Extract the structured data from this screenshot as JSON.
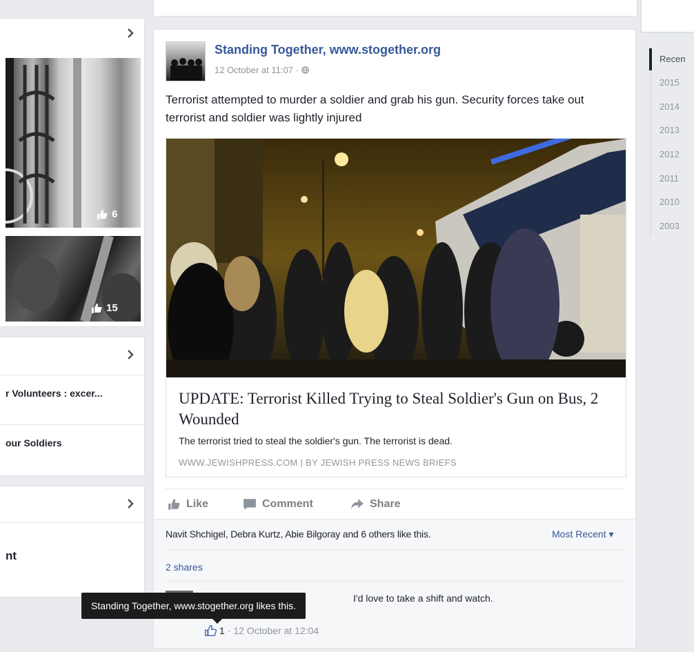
{
  "left": {
    "photo1_likes": "6",
    "photo2_likes": "15",
    "links": [
      {
        "label": "r Volunteers : excer..."
      },
      {
        "label": "our Soldiers"
      }
    ],
    "card3_text": "nt"
  },
  "post": {
    "page_name": "Standing Together, www.stogether.org",
    "timestamp": "12 October at 11:07 · ",
    "text": "Terrorist attempted to murder a soldier and grab his gun. Security forces take out terrorist and soldier was lightly injured",
    "link_preview": {
      "title": "UPDATE: Terrorist Killed Trying to Steal Soldier's Gun on Bus, 2 Wounded",
      "description": "The terrorist tried to steal the soldier's gun. The terrorist is dead.",
      "source": "WWW.JEWISHPRESS.COM | BY JEWISH PRESS NEWS BRIEFS"
    },
    "actions": {
      "like": "Like",
      "comment": "Comment",
      "share": "Share"
    },
    "likes_summary": "Navit Shchigel, Debra Kurtz, Abie Bilgoray and 6 others like this.",
    "sort_label": "Most Recent ▾",
    "shares": "2 shares",
    "comment": {
      "text": "I'd love to take a shift and watch.",
      "likes": "1",
      "timestamp": "· 12 October at 12:04"
    },
    "tooltip": "Standing Together, www.stogether.org likes this."
  },
  "timeline": {
    "recent": "Recen",
    "years": [
      "2015",
      "2014",
      "2013",
      "2012",
      "2011",
      "2010",
      "2003"
    ]
  },
  "colors": {
    "link": "#365899",
    "muted": "#90949c",
    "background": "#e9ebee"
  }
}
